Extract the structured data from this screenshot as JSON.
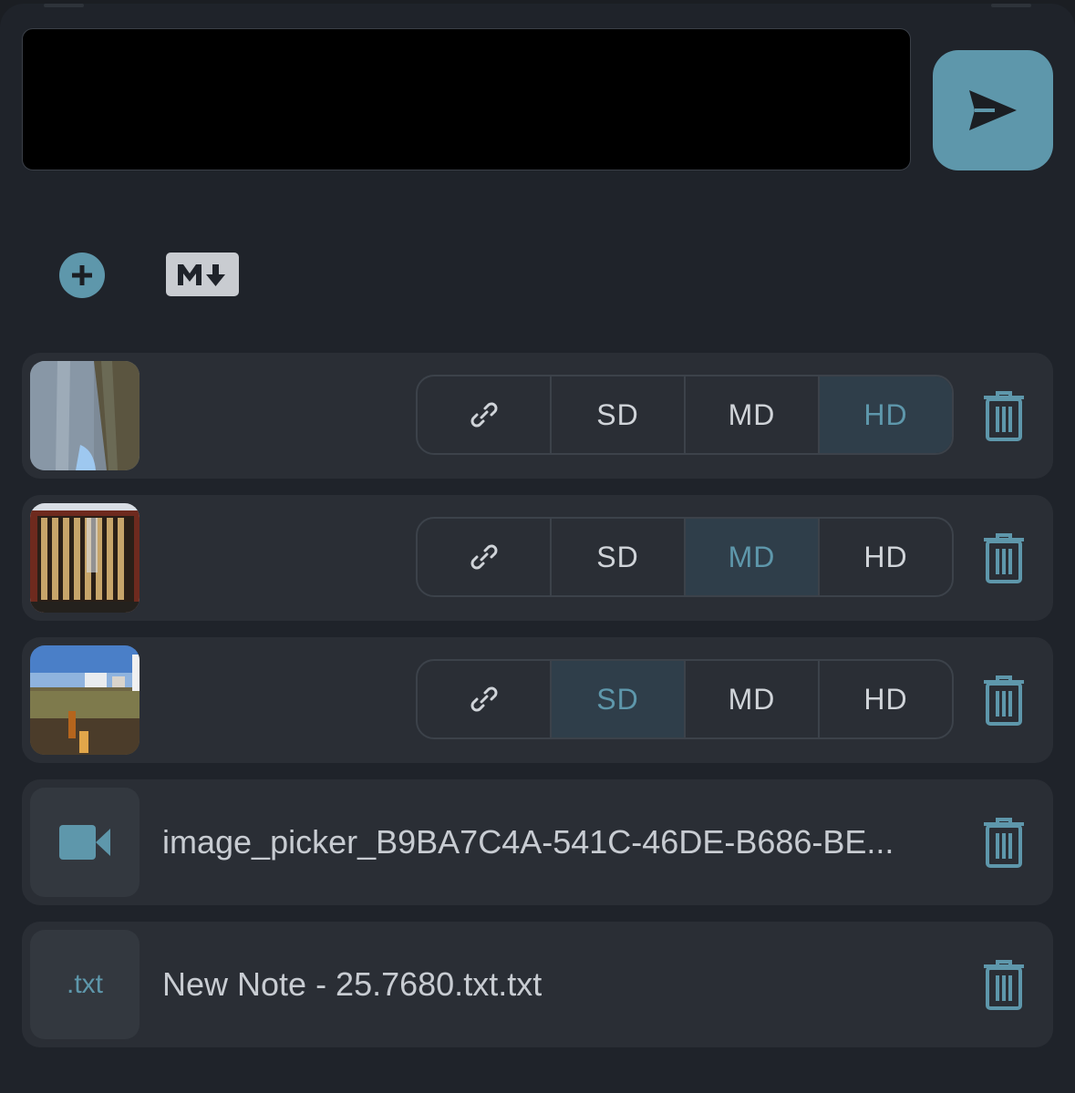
{
  "composer": {
    "placeholder": ""
  },
  "toolbar": {
    "add_icon": "plus-circle-icon",
    "markdown_icon": "markdown-icon"
  },
  "attachments": [
    {
      "kind": "image",
      "selected_quality": "HD",
      "options": [
        "SD",
        "MD",
        "HD"
      ]
    },
    {
      "kind": "image",
      "selected_quality": "MD",
      "options": [
        "SD",
        "MD",
        "HD"
      ]
    },
    {
      "kind": "image",
      "selected_quality": "SD",
      "options": [
        "SD",
        "MD",
        "HD"
      ]
    },
    {
      "kind": "video",
      "filename": "image_picker_B9BA7C4A-541C-46DE-B686-BE..."
    },
    {
      "kind": "text",
      "ext": ".txt",
      "filename": "New Note - 25.7680.txt.txt"
    }
  ],
  "colors": {
    "accent": "#5e97ab",
    "background": "#1f232a",
    "card": "#2a2e35",
    "active_segment": "#2f3e4a"
  }
}
